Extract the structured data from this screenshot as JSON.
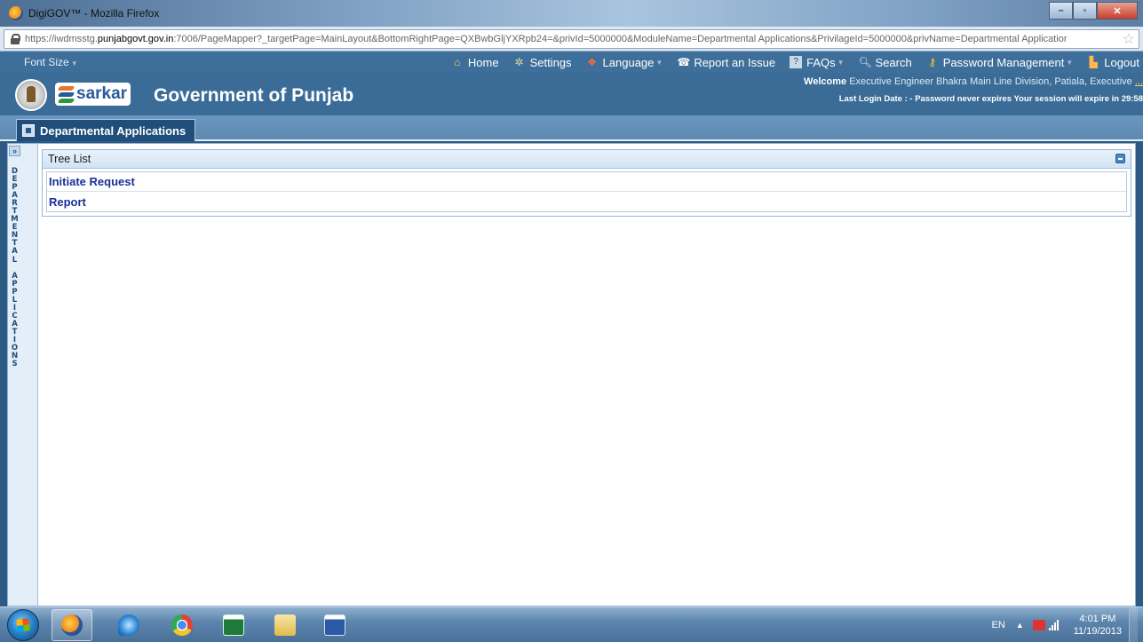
{
  "window": {
    "title": "DigiGOV™ - Mozilla Firefox",
    "url_prefix": "https://iwdmsstg.",
    "url_domain": "punjabgovt.gov.in",
    "url_rest": ":7006/PageMapper?_targetPage=MainLayout&BottomRightPage=QXBwbGljYXRpb24=&privId=5000000&ModuleName=Departmental Applications&PrivilageId=5000000&privName=Departmental Applicatior"
  },
  "topnav": {
    "font_size": "Font Size",
    "items": [
      {
        "label": "Home",
        "icon": "home-icon"
      },
      {
        "label": "Settings",
        "icon": "gear-icon"
      },
      {
        "label": "Language",
        "icon": "language-icon"
      },
      {
        "label": "Report an Issue",
        "icon": "phone-icon"
      },
      {
        "label": "FAQs",
        "icon": "faq-icon"
      },
      {
        "label": "Search",
        "icon": "search-icon"
      },
      {
        "label": "Password Management",
        "icon": "key-icon"
      },
      {
        "label": "Logout",
        "icon": "logout-icon"
      }
    ]
  },
  "header": {
    "brand": "sarkar",
    "title": "Government of Punjab",
    "welcome_label": "Welcome",
    "welcome_text": "Executive Engineer Bhakra Main Line Division, Patiala, Executive",
    "welcome_more": "...",
    "login_info": "Last Login Date : - Password never expires   Your session will expire in 29:58"
  },
  "tab": {
    "label": "Departmental Applications"
  },
  "sidebar": {
    "vertical_label": "DEPARTMENTAL APPLICATIONS"
  },
  "tree": {
    "title": "Tree List",
    "items": [
      {
        "label": "Initiate Request"
      },
      {
        "label": "Report"
      }
    ]
  },
  "taskbar": {
    "apps": [
      "firefox",
      "internet-explorer",
      "chrome",
      "excel",
      "file-explorer",
      "word"
    ],
    "language": "EN",
    "time": "4:01 PM",
    "date": "11/19/2013"
  },
  "colors": {
    "header_blue": "#3a6c97",
    "tree_link": "#1a2f9a",
    "tab_dark": "#1f4e7a"
  }
}
